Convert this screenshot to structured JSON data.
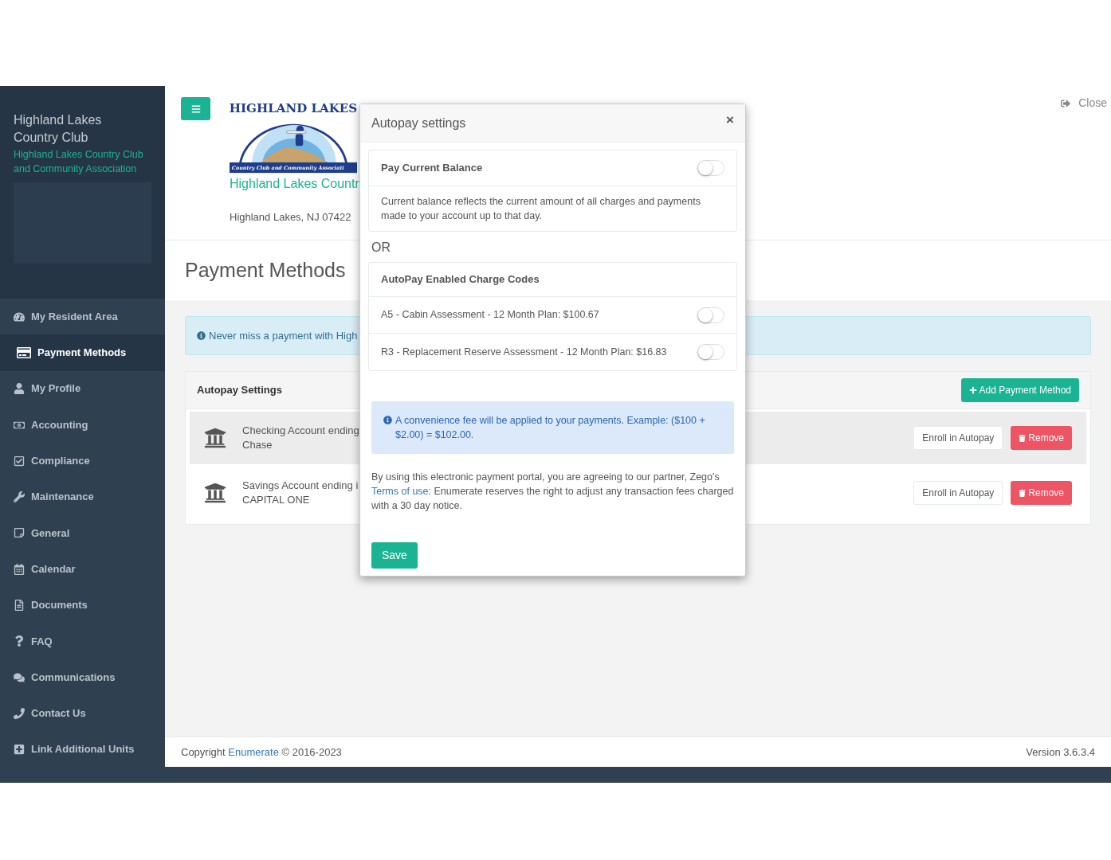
{
  "sidebar": {
    "title": "Highland Lakes Country Club",
    "subtitle": "Highland Lakes Country Club and Community Association",
    "items": [
      {
        "label": "My Resident Area",
        "selected": false
      },
      {
        "label": "Payment Methods",
        "selected": true
      },
      {
        "label": "My Profile",
        "selected": false
      },
      {
        "label": "Accounting",
        "selected": false
      },
      {
        "label": "Compliance",
        "selected": false
      },
      {
        "label": "Maintenance",
        "selected": false
      },
      {
        "label": "General",
        "selected": false
      },
      {
        "label": "Calendar",
        "selected": false
      },
      {
        "label": "Documents",
        "selected": false
      },
      {
        "label": "FAQ",
        "selected": false
      },
      {
        "label": "Communications",
        "selected": false
      },
      {
        "label": "Contact Us",
        "selected": false
      },
      {
        "label": "Link Additional Units",
        "selected": false
      }
    ]
  },
  "header": {
    "logo": {
      "ring_text": "HIGHLAND LAKES",
      "banner_text": "Country Club and Community Associati"
    },
    "org_name": "Highland Lakes Countr",
    "address": "Highland Lakes, NJ 07422",
    "close": "Close"
  },
  "page_title": "Payment Methods",
  "info_alert": "Never miss a payment with High",
  "panel": {
    "title": "Autopay Settings",
    "add_button": "Add Payment Method",
    "rows": [
      {
        "name": "Checking Account ending",
        "bank": "Chase",
        "highlighted": true,
        "enroll": "Enroll in Autopay",
        "remove": "Remove"
      },
      {
        "name": "Savings Account ending i",
        "bank": "CAPITAL ONE",
        "highlighted": false,
        "enroll": "Enroll in Autopay",
        "remove": "Remove"
      }
    ]
  },
  "footer": {
    "copyright_prefix": "Copyright",
    "link": "Enumerate",
    "copyright_suffix": "© 2016-2023",
    "version": "Version 3.6.3.4"
  },
  "modal": {
    "title": "Autopay settings",
    "close": "×",
    "balance": {
      "label": "Pay Current Balance",
      "on": false,
      "description": "Current balance reflects the current amount of all charges and payments made to your account up to that day."
    },
    "or": "OR",
    "charge_codes": {
      "title": "AutoPay Enabled Charge Codes",
      "items": [
        {
          "label": "A5 - Cabin Assessment - 12 Month Plan: $100.67",
          "on": false
        },
        {
          "label": "R3 - Replacement Reserve Assessment - 12 Month Plan: $16.83",
          "on": false
        }
      ]
    },
    "fee_alert": "A convenience fee will be applied to your payments. Example: ($100 + $2.00) = $102.00.",
    "terms_before": "By using this electronic payment portal, you are agreeing to our partner, Zego's ",
    "terms_link": "Terms of use",
    "terms_after": ": Enumerate reserves the right to adjust any transaction fees charged with a 30 day notice.",
    "save": "Save"
  }
}
